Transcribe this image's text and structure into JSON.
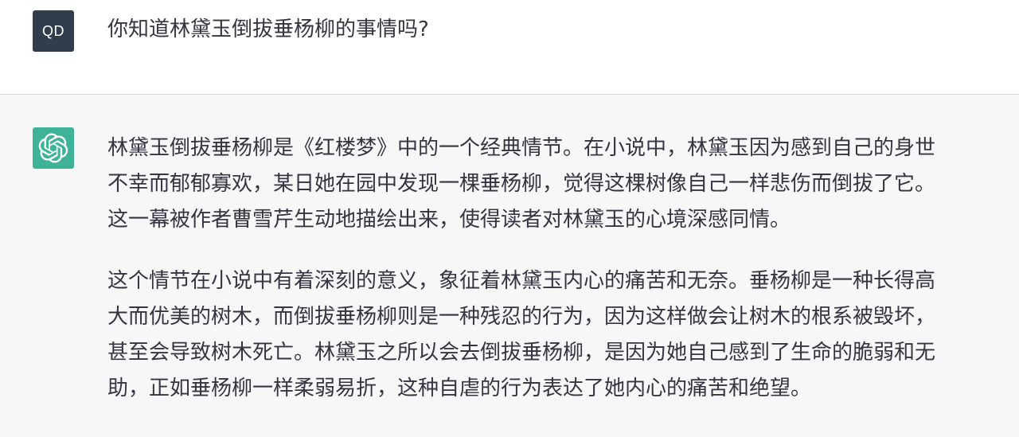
{
  "user_turn": {
    "avatar_initials": "QD",
    "question": "你知道林黛玉倒拔垂杨柳的事情吗?"
  },
  "assistant_turn": {
    "avatar_icon": "openai-logo-icon",
    "paragraphs": [
      {
        "lines": [
          "林黛玉倒拔垂杨柳是《红楼梦》中的一个经典情节。在小说中，林黛玉因为感到自己的身世",
          "不幸而郁郁寡欢，某日她在园中发现一棵垂杨柳，觉得这棵树像自己一样悲伤而倒拔了它。",
          "这一幕被作者曹雪芹生动地描绘出来，使得读者对林黛玉的心境深感同情。"
        ]
      },
      {
        "lines": [
          "这个情节在小说中有着深刻的意义，象征着林黛玉内心的痛苦和无奈。垂杨柳是一种长得高",
          "大而优美的树木，而倒拔垂杨柳则是一种残忍的行为，因为这样做会让树木的根系被毁坏，",
          "甚至会导致树木死亡。林黛玉之所以会去倒拔垂杨柳，是因为她自己感到了生命的脆弱和无",
          "助，正如垂杨柳一样柔弱易折，这种自虐的行为表达了她内心的痛苦和绝望。"
        ]
      }
    ]
  },
  "colors": {
    "user_avatar_bg": "#313c4d",
    "bot_avatar_bg": "#10a37f",
    "assistant_bg": "#f7f7f8",
    "text": "#343541"
  }
}
